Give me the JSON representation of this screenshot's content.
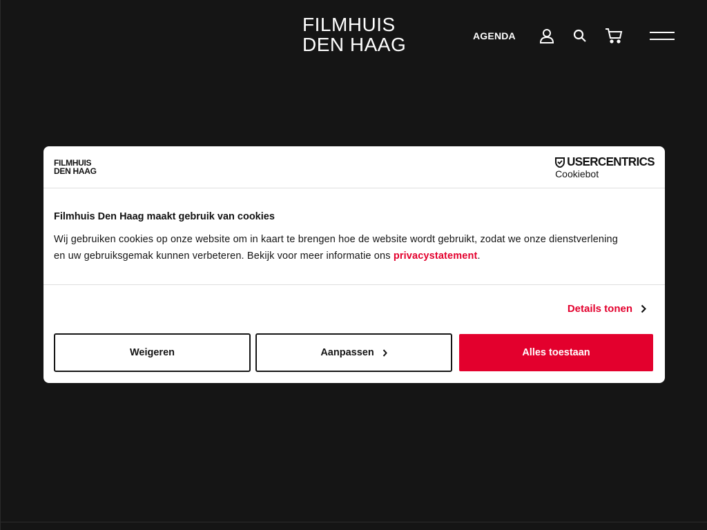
{
  "header": {
    "logo_line1": "FILMHUIS",
    "logo_line2": "DEN HAAG",
    "nav_agenda": "AGENDA",
    "icons": [
      "user-icon",
      "search-icon",
      "cart-icon",
      "menu-icon"
    ]
  },
  "dialog": {
    "logo_line1": "FILMHUIS",
    "logo_line2": "DEN HAAG",
    "brand_name": "USERCENTRICS",
    "brand_sub": "Cookiebot",
    "title": "Filmhuis Den Haag maakt gebruik van cookies",
    "text": "Wij gebruiken cookies op onze website om in kaart te brengen hoe de website wordt gebruikt, zodat we onze dienstverlening en uw gebruiksgemak kunnen verbeteren. Bekijk voor meer informatie ons ",
    "privacy_link": "privacystatement",
    "text_end": ".",
    "details_label": "Details tonen",
    "buttons": {
      "reject": "Weigeren",
      "customize": "Aanpassen",
      "accept_all": "Alles toestaan"
    }
  },
  "colors": {
    "background": "#151515",
    "accent": "#e3002d",
    "dialog_bg": "#ffffff"
  }
}
